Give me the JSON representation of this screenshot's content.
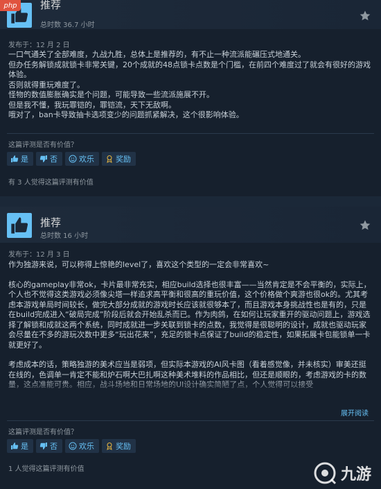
{
  "watermark": {
    "badge": "php",
    "brand": "九游"
  },
  "reviews": [
    {
      "verdict": "推荐",
      "hours": "总时数 36.7 小时",
      "posted": "发布于：12 月 2 日",
      "paragraphs": [
        "一口气通关了全部难度，九战九胜，总体上是推荐的，有不止一种流派能碾压式地通关。",
        "但办任务解锁成就锁卡非常关键，20个成就的48点锁卡点数是个门槛，在前四个难度过了就会有很好的游戏体验。",
        "否则就得重玩难度了。",
        "怪物的数值膨胀确实是个问题，可能导致一些流派施展不开。",
        "但是我不懂，我玩罪铠的，罪铠流，天下无敌啊。",
        "哦对了，ban卡导致抽卡选项变少的问题抓紧解决，这个很影响体验。"
      ],
      "helpful_question": "这篇评测是否有价值？",
      "buttons": {
        "yes": "是",
        "no": "否",
        "funny": "欢乐",
        "award": "奖励"
      },
      "found_helpful": "有 3 人觉得这篇评测有价值"
    },
    {
      "verdict": "推荐",
      "hours": "总时数 16 小时",
      "posted": "发布于：12 月 3 日",
      "paragraphs": [
        "作为独游来说，可以称得上惊艳的level了，喜欢这个类型的一定会非常喜欢~",
        "",
        "核心的gameplay非常ok，卡片最非常充实，相应build选择也很丰富——当然肯定是不会平衡的，实际上，个人也不觉得这类游戏必须像尖塔一样追求高平衡和很高的重玩价值，这个价格做个爽游也很ok的。尤其考虑本游戏单局时间较长，做完大部分成就的游戏时长应该就很够本了，而且游戏本身挑战性也是有的，只是在build完成进入“破局完成”阶段后就会开始乱杀而已。作为肉鸽，在如何让玩家重开的驱动问题上，游戏选择了解锁和成就这两个系统，同时成就进一步关联到锁卡的点数，我觉得是很聪明的设计，成就也驱动玩家会尽量在不多的游玩次数中更多“玩出花来”，充足的锁卡点保证了build的稳定性，如果拓展卡包能锁单一卡就更好了。",
        "",
        "考虑成本的话，策略独游的美术应当是弱项，但实际本游戏的AI风卡图（看着感觉像，并未核实）审美还挺在线的，色调单一肯定不能和炉石啊大巴扎啊这种美术堆料的作品相比，但还是顺眼的，考虑游戏的卡的数量，这点准能可贵。相应，战斗场地和日常场地的UI设计确实简陋了点，个人觉得可以接受"
      ],
      "expand": "展开阅读",
      "helpful_question": "这篇评测是否有价值？",
      "buttons": {
        "yes": "是",
        "no": "否",
        "funny": "欢乐",
        "award": "奖励"
      },
      "found_helpful": "1 人觉得这篇评测有价值"
    }
  ],
  "colors": {
    "accent": "#66c0f4",
    "background": "#1b2838",
    "card": "#16202d"
  }
}
